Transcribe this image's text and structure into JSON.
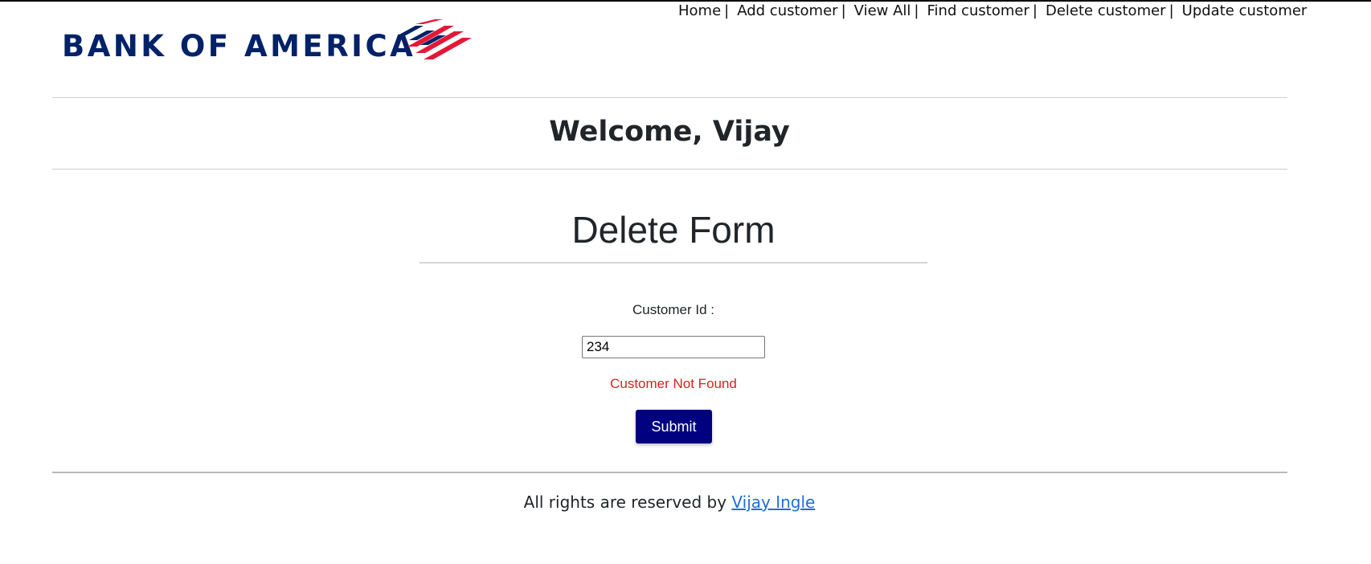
{
  "brand": {
    "logo_text": "BANK OF AMERICA",
    "logo_color": "#012169",
    "flag_red": "#E31837",
    "flag_navy": "#012169"
  },
  "nav": {
    "items": [
      "Home",
      "Add customer",
      "View All",
      "Find customer",
      "Delete customer",
      "Update customer"
    ],
    "separator": "|"
  },
  "header": {
    "welcome": "Welcome, Vijay"
  },
  "form": {
    "title": "Delete Form",
    "customer_id_label": "Customer Id :",
    "customer_id_value": "234",
    "error_message": "Customer Not Found",
    "submit_label": "Submit",
    "submit_color": "#000080",
    "error_color": "#D9211F"
  },
  "footer": {
    "text": "All rights are reserved by",
    "author": "Vijay Ingle",
    "link_color": "#1D6FD6"
  }
}
